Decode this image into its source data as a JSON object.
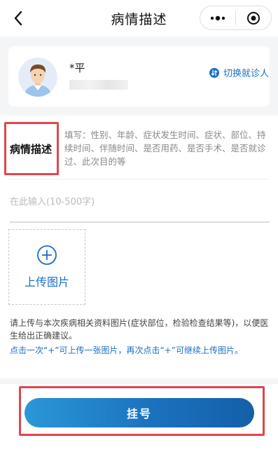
{
  "nav": {
    "title": "病情描述"
  },
  "patient": {
    "name": "*平",
    "switch_label": "切换就诊人"
  },
  "form": {
    "desc_label": "病情描述",
    "desc_hint": "填写：性别、年龄、症状发生时间、症状、部位、持续时间、伴随时间、是否用药、是否手术、是否就诊过、此次目的等",
    "input_placeholder": "在此输入(10-500字)",
    "upload_label": "上传图片",
    "note": "请上传与本次疾病相关资料图片(症状部位，检验检查结果等)，以便医生给出正确建议。",
    "note_highlight": "点击一次“+”可上传一张图片，再次点击“+”可继续上传图片。"
  },
  "footer": {
    "register_label": "挂号"
  },
  "colors": {
    "accent": "#1a6fc4",
    "highlight_box": "#e0454d"
  },
  "icons": {
    "back": "chevron-left-icon",
    "more": "more-dots-icon",
    "close": "close-target-icon",
    "switch": "switch-icon",
    "add": "plus-circle-icon"
  }
}
